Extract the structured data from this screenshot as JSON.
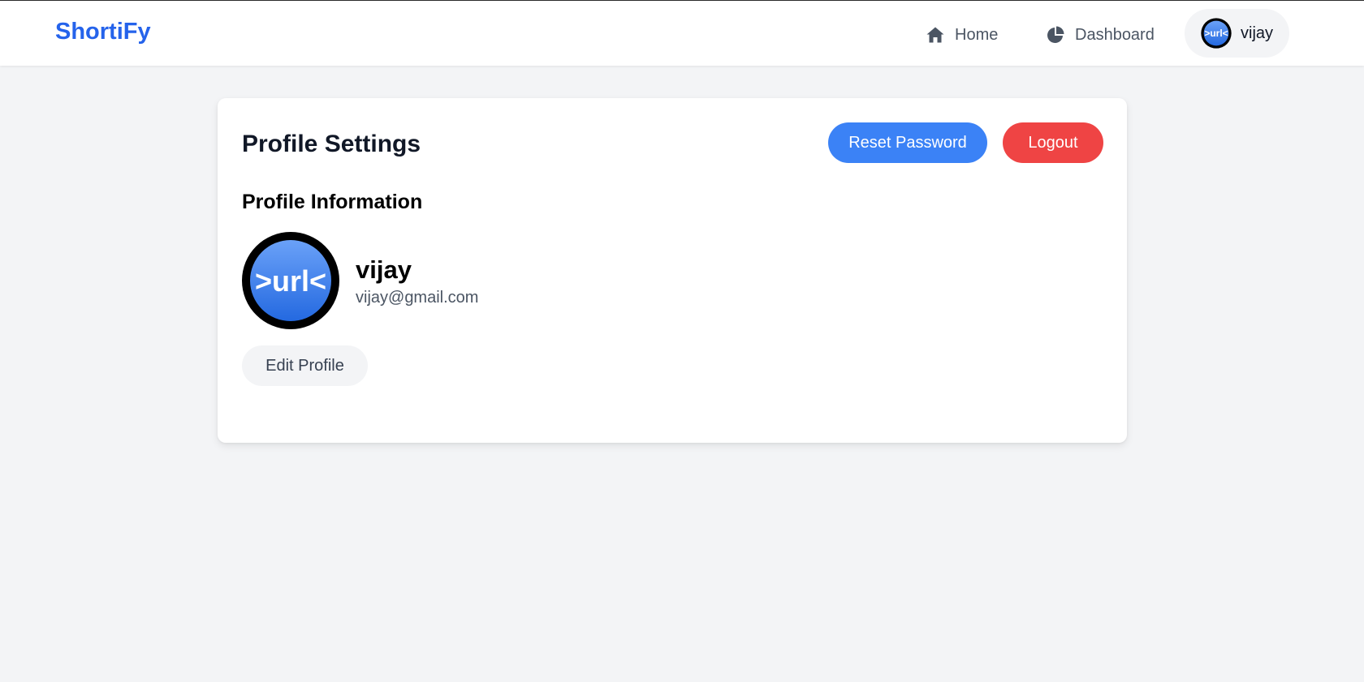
{
  "brand": {
    "name": "ShortiFy",
    "color": "#2563eb"
  },
  "nav": {
    "home": {
      "label": "Home",
      "icon": "home-icon"
    },
    "dashboard": {
      "label": "Dashboard",
      "icon": "pie-chart-icon"
    },
    "user": {
      "name": "vijay",
      "avatar_text": ">url<"
    }
  },
  "card": {
    "title": "Profile Settings",
    "reset_password_label": "Reset Password",
    "logout_label": "Logout",
    "section_title": "Profile Information",
    "profile": {
      "name": "vijay",
      "email": "vijay@gmail.com",
      "avatar_text": ">url<"
    },
    "edit_profile_label": "Edit Profile"
  },
  "colors": {
    "primary": "#3b82f6",
    "danger": "#ef4444",
    "background": "#f3f4f6"
  }
}
